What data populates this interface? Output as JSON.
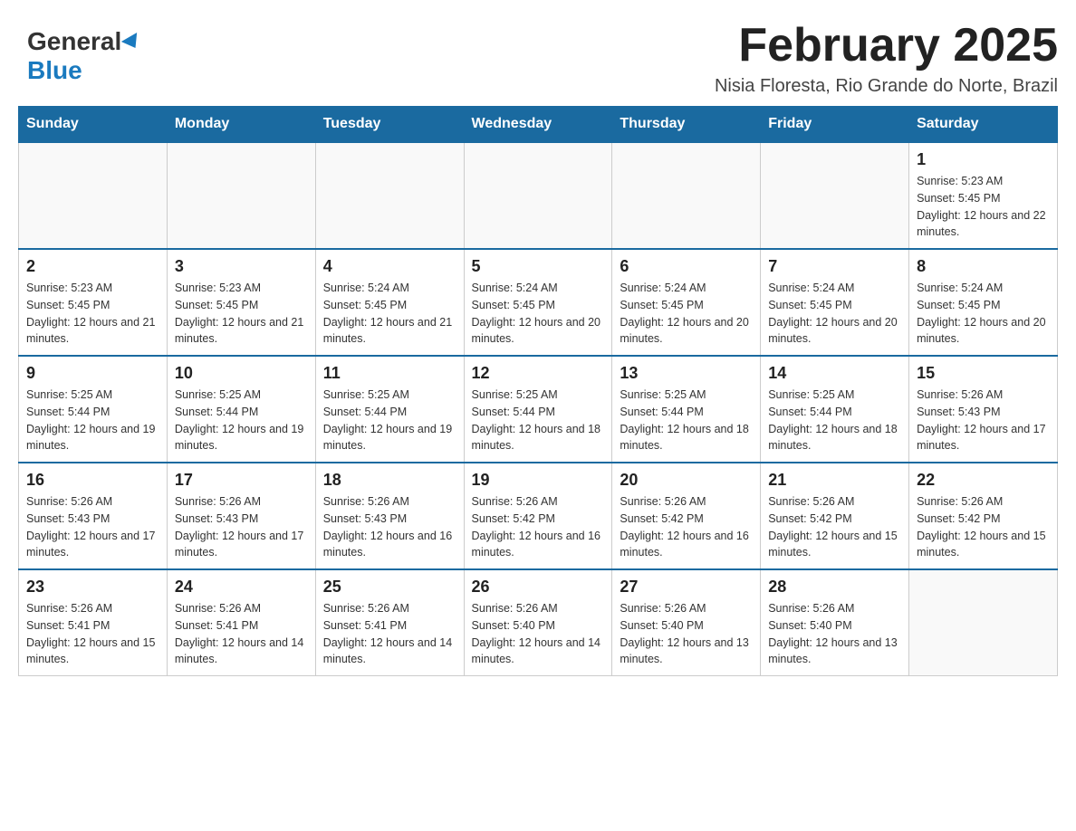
{
  "header": {
    "logo_general": "General",
    "logo_blue": "Blue",
    "month_title": "February 2025",
    "location": "Nisia Floresta, Rio Grande do Norte, Brazil"
  },
  "days_of_week": [
    "Sunday",
    "Monday",
    "Tuesday",
    "Wednesday",
    "Thursday",
    "Friday",
    "Saturday"
  ],
  "weeks": [
    [
      {
        "day": "",
        "sunrise": "",
        "sunset": "",
        "daylight": ""
      },
      {
        "day": "",
        "sunrise": "",
        "sunset": "",
        "daylight": ""
      },
      {
        "day": "",
        "sunrise": "",
        "sunset": "",
        "daylight": ""
      },
      {
        "day": "",
        "sunrise": "",
        "sunset": "",
        "daylight": ""
      },
      {
        "day": "",
        "sunrise": "",
        "sunset": "",
        "daylight": ""
      },
      {
        "day": "",
        "sunrise": "",
        "sunset": "",
        "daylight": ""
      },
      {
        "day": "1",
        "sunrise": "Sunrise: 5:23 AM",
        "sunset": "Sunset: 5:45 PM",
        "daylight": "Daylight: 12 hours and 22 minutes."
      }
    ],
    [
      {
        "day": "2",
        "sunrise": "Sunrise: 5:23 AM",
        "sunset": "Sunset: 5:45 PM",
        "daylight": "Daylight: 12 hours and 21 minutes."
      },
      {
        "day": "3",
        "sunrise": "Sunrise: 5:23 AM",
        "sunset": "Sunset: 5:45 PM",
        "daylight": "Daylight: 12 hours and 21 minutes."
      },
      {
        "day": "4",
        "sunrise": "Sunrise: 5:24 AM",
        "sunset": "Sunset: 5:45 PM",
        "daylight": "Daylight: 12 hours and 21 minutes."
      },
      {
        "day": "5",
        "sunrise": "Sunrise: 5:24 AM",
        "sunset": "Sunset: 5:45 PM",
        "daylight": "Daylight: 12 hours and 20 minutes."
      },
      {
        "day": "6",
        "sunrise": "Sunrise: 5:24 AM",
        "sunset": "Sunset: 5:45 PM",
        "daylight": "Daylight: 12 hours and 20 minutes."
      },
      {
        "day": "7",
        "sunrise": "Sunrise: 5:24 AM",
        "sunset": "Sunset: 5:45 PM",
        "daylight": "Daylight: 12 hours and 20 minutes."
      },
      {
        "day": "8",
        "sunrise": "Sunrise: 5:24 AM",
        "sunset": "Sunset: 5:45 PM",
        "daylight": "Daylight: 12 hours and 20 minutes."
      }
    ],
    [
      {
        "day": "9",
        "sunrise": "Sunrise: 5:25 AM",
        "sunset": "Sunset: 5:44 PM",
        "daylight": "Daylight: 12 hours and 19 minutes."
      },
      {
        "day": "10",
        "sunrise": "Sunrise: 5:25 AM",
        "sunset": "Sunset: 5:44 PM",
        "daylight": "Daylight: 12 hours and 19 minutes."
      },
      {
        "day": "11",
        "sunrise": "Sunrise: 5:25 AM",
        "sunset": "Sunset: 5:44 PM",
        "daylight": "Daylight: 12 hours and 19 minutes."
      },
      {
        "day": "12",
        "sunrise": "Sunrise: 5:25 AM",
        "sunset": "Sunset: 5:44 PM",
        "daylight": "Daylight: 12 hours and 18 minutes."
      },
      {
        "day": "13",
        "sunrise": "Sunrise: 5:25 AM",
        "sunset": "Sunset: 5:44 PM",
        "daylight": "Daylight: 12 hours and 18 minutes."
      },
      {
        "day": "14",
        "sunrise": "Sunrise: 5:25 AM",
        "sunset": "Sunset: 5:44 PM",
        "daylight": "Daylight: 12 hours and 18 minutes."
      },
      {
        "day": "15",
        "sunrise": "Sunrise: 5:26 AM",
        "sunset": "Sunset: 5:43 PM",
        "daylight": "Daylight: 12 hours and 17 minutes."
      }
    ],
    [
      {
        "day": "16",
        "sunrise": "Sunrise: 5:26 AM",
        "sunset": "Sunset: 5:43 PM",
        "daylight": "Daylight: 12 hours and 17 minutes."
      },
      {
        "day": "17",
        "sunrise": "Sunrise: 5:26 AM",
        "sunset": "Sunset: 5:43 PM",
        "daylight": "Daylight: 12 hours and 17 minutes."
      },
      {
        "day": "18",
        "sunrise": "Sunrise: 5:26 AM",
        "sunset": "Sunset: 5:43 PM",
        "daylight": "Daylight: 12 hours and 16 minutes."
      },
      {
        "day": "19",
        "sunrise": "Sunrise: 5:26 AM",
        "sunset": "Sunset: 5:42 PM",
        "daylight": "Daylight: 12 hours and 16 minutes."
      },
      {
        "day": "20",
        "sunrise": "Sunrise: 5:26 AM",
        "sunset": "Sunset: 5:42 PM",
        "daylight": "Daylight: 12 hours and 16 minutes."
      },
      {
        "day": "21",
        "sunrise": "Sunrise: 5:26 AM",
        "sunset": "Sunset: 5:42 PM",
        "daylight": "Daylight: 12 hours and 15 minutes."
      },
      {
        "day": "22",
        "sunrise": "Sunrise: 5:26 AM",
        "sunset": "Sunset: 5:42 PM",
        "daylight": "Daylight: 12 hours and 15 minutes."
      }
    ],
    [
      {
        "day": "23",
        "sunrise": "Sunrise: 5:26 AM",
        "sunset": "Sunset: 5:41 PM",
        "daylight": "Daylight: 12 hours and 15 minutes."
      },
      {
        "day": "24",
        "sunrise": "Sunrise: 5:26 AM",
        "sunset": "Sunset: 5:41 PM",
        "daylight": "Daylight: 12 hours and 14 minutes."
      },
      {
        "day": "25",
        "sunrise": "Sunrise: 5:26 AM",
        "sunset": "Sunset: 5:41 PM",
        "daylight": "Daylight: 12 hours and 14 minutes."
      },
      {
        "day": "26",
        "sunrise": "Sunrise: 5:26 AM",
        "sunset": "Sunset: 5:40 PM",
        "daylight": "Daylight: 12 hours and 14 minutes."
      },
      {
        "day": "27",
        "sunrise": "Sunrise: 5:26 AM",
        "sunset": "Sunset: 5:40 PM",
        "daylight": "Daylight: 12 hours and 13 minutes."
      },
      {
        "day": "28",
        "sunrise": "Sunrise: 5:26 AM",
        "sunset": "Sunset: 5:40 PM",
        "daylight": "Daylight: 12 hours and 13 minutes."
      },
      {
        "day": "",
        "sunrise": "",
        "sunset": "",
        "daylight": ""
      }
    ]
  ]
}
